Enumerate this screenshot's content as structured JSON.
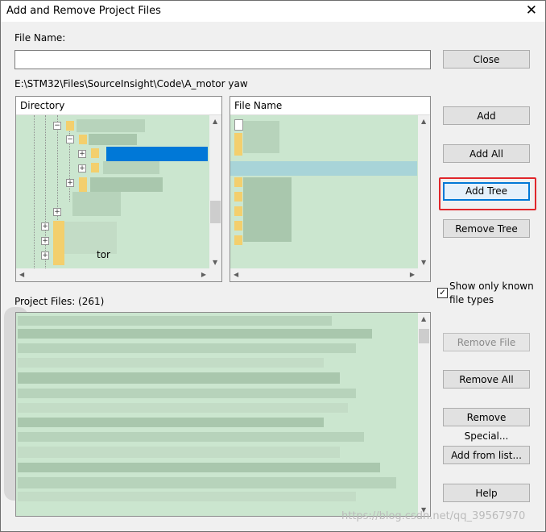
{
  "window": {
    "title": "Add and Remove Project Files",
    "close_glyph": "✕"
  },
  "file_name": {
    "label": "File Name:",
    "value": ""
  },
  "path": "E:\\STM32\\Files\\SourceInsight\\Code\\A_motor yaw",
  "directory_pane": {
    "header": "Directory",
    "visible_text": "tor"
  },
  "file_pane": {
    "header": "File Name"
  },
  "project_files": {
    "label": "Project Files: (261)"
  },
  "buttons": {
    "close": "Close",
    "add": "Add",
    "add_all": "Add All",
    "add_tree": "Add Tree",
    "remove_tree": "Remove Tree",
    "remove_file": "Remove File",
    "remove_all": "Remove All",
    "remove_special": "Remove Special...",
    "add_from_list": "Add from list...",
    "help": "Help"
  },
  "show_only_known": {
    "label_line1": "Show only known",
    "label_line2": "file types",
    "checked": true,
    "check_glyph": "✓"
  },
  "watermark": "https://blog.csdn.net/qq_39567970",
  "colors": {
    "list_bg": "#cbe6cf",
    "selection": "#0078d7",
    "highlight_box": "#e0262b"
  }
}
